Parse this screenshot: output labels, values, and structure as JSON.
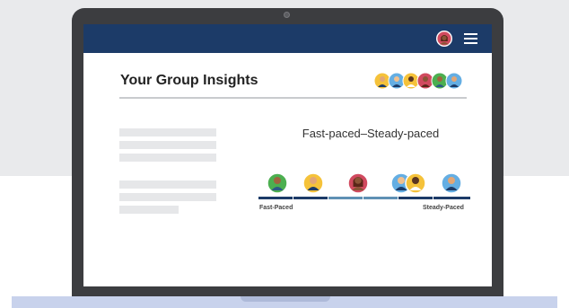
{
  "insights": {
    "title": "Your Group Insights",
    "scale_title": "Fast-paced–Steady-paced",
    "left_label": "Fast-Paced",
    "right_label": "Steady-Paced"
  },
  "colors": {
    "navbar": "#1c3b68",
    "scale_primary": "#1c3b68",
    "scale_secondary": "#5f90b4",
    "avatar_green": "#4caf50",
    "avatar_yellow": "#f5c23a",
    "avatar_red": "#d14a5f",
    "avatar_blue": "#64aee3"
  }
}
